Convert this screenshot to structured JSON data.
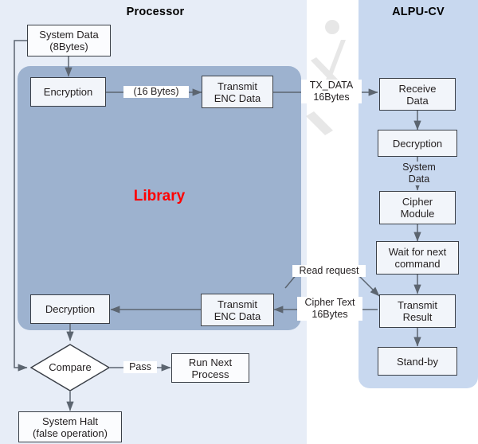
{
  "panels": {
    "processor": {
      "title": "Processor",
      "accent": "#e7edf7"
    },
    "alpu": {
      "title": "ALPU-CV",
      "accent": "#c8d8ef"
    }
  },
  "library": {
    "label": "Library",
    "color": "#ff0000"
  },
  "processor_nodes": {
    "system_data": "System Data\n(8Bytes)",
    "encryption": "Encryption",
    "transmit_enc_data_top": "Transmit\nENC Data",
    "decryption": "Decryption",
    "transmit_enc_data_bottom": "Transmit\nENC Data",
    "compare": "Compare",
    "run_next_process": "Run Next\nProcess",
    "system_halt": "System Halt\n(false operation)"
  },
  "alpu_nodes": {
    "receive_data": "Receive\nData",
    "decryption": "Decryption",
    "cipher_module": "Cipher\nModule",
    "wait_for_next_command": "Wait for next\ncommand",
    "transmit_result": "Transmit\nResult",
    "standby": "Stand-by"
  },
  "edge_labels": {
    "sixteen_bytes": "(16 Bytes)",
    "tx_data": "TX_DATA\n16Bytes",
    "system_data": "System\nData",
    "read_request": "Read request",
    "cipher_text": "Cipher Text\n16Bytes",
    "pass": "Pass"
  },
  "icons": {
    "watermark": "watermark-logo"
  }
}
